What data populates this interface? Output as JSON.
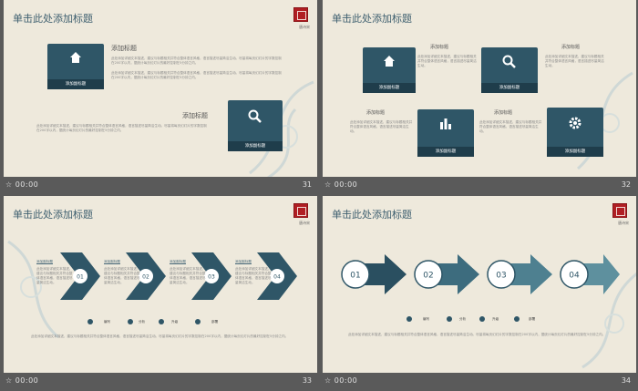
{
  "slides": [
    {
      "title": "单击此处添加标题",
      "seal_caption": "唐诗宋",
      "time": "00:00",
      "page": "31",
      "heading_1": "添加标题",
      "heading_2": "添加标题",
      "card_label": "添加副标题",
      "body_a": "此处添加详细文本描述，建议与标题相关并符合整体语言风格，语言描述尽量简洁生动。尽量将每页幻灯片的字数控制在200字以内，据统计每页幻灯片的最好控制在5分钟之内。"
    },
    {
      "title": "单击此处添加标题",
      "time": "00:00",
      "page": "32",
      "heading": "添加标题",
      "card_label": "添加副标题",
      "body_a": "此处添加详细文本描述，建议与标题相关并符合整体语言风格，语言描述尽量简洁生动。"
    },
    {
      "title": "单击此处添加标题",
      "seal_caption": "唐诗宋",
      "time": "00:00",
      "page": "33",
      "step_label": "添加副标题",
      "steps": [
        "01",
        "02",
        "03",
        "04"
      ],
      "step_text": "此处添加详细文本描述，建议与标题相关并符合整体语言风格，语言描述尽量简洁生动。",
      "legend": [
        "编写",
        "分析",
        "升级",
        "部署"
      ],
      "body_a": "此处添加详细文本描述，建议与标题相关并符合整体语言风格，语言描述尽量简洁生动。尽量将每页幻灯片的字数控制在200字以内，据统计每页幻灯片的最好控制在5分钟之内。"
    },
    {
      "title": "单击此处添加标题",
      "seal_caption": "唐诗宋",
      "time": "00:00",
      "page": "34",
      "steps": [
        "01",
        "02",
        "03",
        "04"
      ],
      "legend": [
        "编写",
        "分析",
        "升级",
        "部署"
      ],
      "body_a": "此处添加详细文本描述，建议与标题相关并符合整体语言风格，语言描述尽量简洁生动。尽量将每页幻灯片的字数控制在200字以内，据统计每页幻灯片的最好控制在5分钟之内。"
    }
  ],
  "colors": {
    "bg": "#5a5a5a",
    "paper": "#eee9dc",
    "teal": "#2f5667",
    "teal_dark": "#1f3d4b",
    "seal": "#b01e23"
  }
}
